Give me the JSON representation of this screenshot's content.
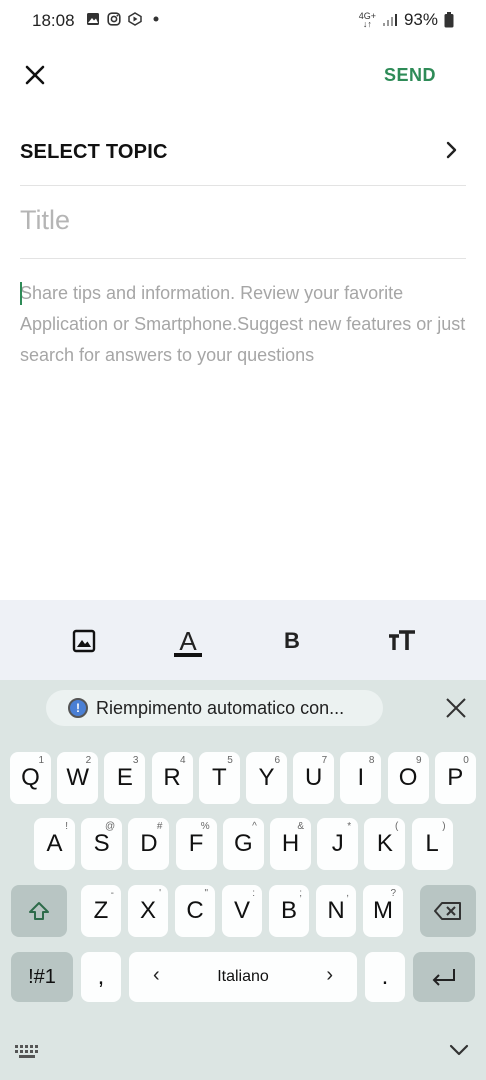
{
  "status_bar": {
    "time": "18:08",
    "battery": "93%",
    "network_top": "4G+",
    "network_bottom": "↓↑"
  },
  "app_bar": {
    "close_icon": "close-icon",
    "send_label": "SEND",
    "accent_color": "#2e8b57"
  },
  "topic": {
    "label": "SELECT TOPIC"
  },
  "title": {
    "placeholder": "Title",
    "value": ""
  },
  "body": {
    "placeholder": "Share tips and information. Review your favorite Application or Smartphone.Suggest new features or just search for answers to your questions",
    "value": ""
  },
  "format_toolbar": {
    "items": [
      "image-icon",
      "text-color-icon",
      "bold-icon",
      "text-size-icon"
    ],
    "text_color_glyph": "A",
    "bold_glyph": "B"
  },
  "keyboard": {
    "suggestion": "Riempimento automatico con...",
    "row1": [
      {
        "k": "Q",
        "h": "1"
      },
      {
        "k": "W",
        "h": "2"
      },
      {
        "k": "E",
        "h": "3"
      },
      {
        "k": "R",
        "h": "4"
      },
      {
        "k": "T",
        "h": "5"
      },
      {
        "k": "Y",
        "h": "6"
      },
      {
        "k": "U",
        "h": "7"
      },
      {
        "k": "I",
        "h": "8"
      },
      {
        "k": "O",
        "h": "9"
      },
      {
        "k": "P",
        "h": "0"
      }
    ],
    "row2": [
      {
        "k": "A",
        "h": "!"
      },
      {
        "k": "S",
        "h": "@"
      },
      {
        "k": "D",
        "h": "#"
      },
      {
        "k": "F",
        "h": "%"
      },
      {
        "k": "G",
        "h": "^"
      },
      {
        "k": "H",
        "h": "&"
      },
      {
        "k": "J",
        "h": "*"
      },
      {
        "k": "K",
        "h": "("
      },
      {
        "k": "L",
        "h": ")"
      }
    ],
    "row3": [
      {
        "k": "Z",
        "h": "-"
      },
      {
        "k": "X",
        "h": "'"
      },
      {
        "k": "C",
        "h": "\""
      },
      {
        "k": "V",
        "h": ":"
      },
      {
        "k": "B",
        "h": ";"
      },
      {
        "k": "N",
        "h": ","
      },
      {
        "k": "M",
        "h": "?"
      }
    ],
    "symbols_label": "!#1",
    "comma": ",",
    "space_label": "Italiano",
    "period": ".",
    "left_arrow": "‹",
    "right_arrow": "›"
  }
}
